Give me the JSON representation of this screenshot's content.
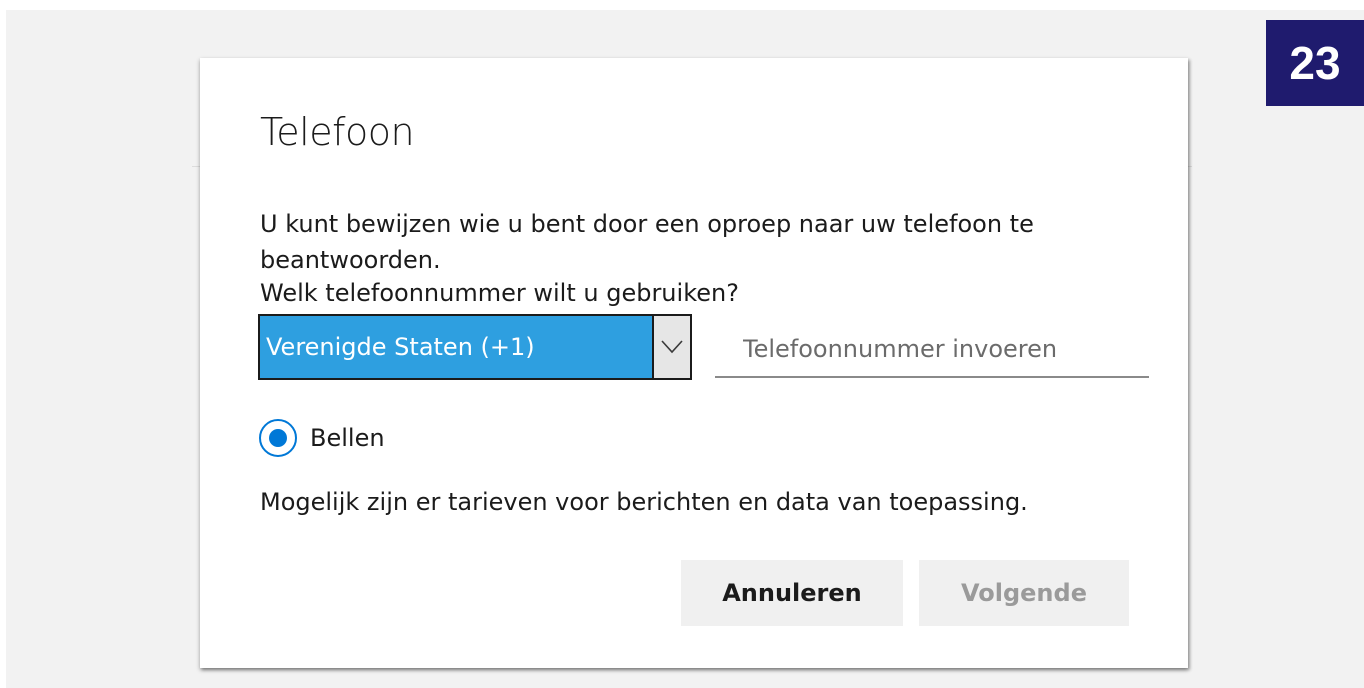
{
  "badge": {
    "number": "23",
    "color": "#1f1b6e"
  },
  "dialog": {
    "title": "Telefoon",
    "description": "U kunt bewijzen wie u bent door een oproep naar uw telefoon te beantwoorden.",
    "question": "Welk telefoonnummer wilt u gebruiken?",
    "country_select": {
      "value": "Verenigde Staten (+1)",
      "highlight_color": "#2e9fe0",
      "icon": "chevron-down-icon"
    },
    "phone_input": {
      "value": "",
      "placeholder": "Telefoonnummer invoeren"
    },
    "method_option": {
      "label": "Bellen",
      "selected": true,
      "accent_color": "#0078d7"
    },
    "note": "Mogelijk zijn er tarieven voor berichten en data van toepassing.",
    "buttons": {
      "cancel": "Annuleren",
      "next": "Volgende"
    }
  }
}
